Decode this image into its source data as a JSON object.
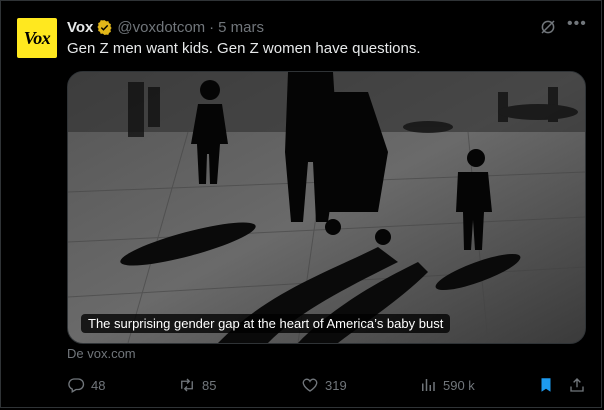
{
  "tweet": {
    "avatar_text": "Vox",
    "author_name": "Vox",
    "handle": "@voxdotcom",
    "separator": "·",
    "date": "5 mars",
    "text": "Gen Z men want kids. Gen Z women have questions."
  },
  "card": {
    "caption": "The surprising gender gap at the heart of America’s baby bust",
    "source": "De vox.com"
  },
  "actions": {
    "replies": "48",
    "reposts": "85",
    "likes": "319",
    "views": "590 k"
  },
  "icons": [
    "verified-badge-icon",
    "grok-icon",
    "more-icon",
    "reply-icon",
    "repost-icon",
    "like-icon",
    "views-icon",
    "bookmark-icon",
    "share-icon"
  ],
  "colors": {
    "background": "#000000",
    "text": "#e7e9ea",
    "muted": "#71767b",
    "avatar_bg": "#ffe81f",
    "verified": "#e2b719",
    "bookmark": "#1d9bf0"
  }
}
